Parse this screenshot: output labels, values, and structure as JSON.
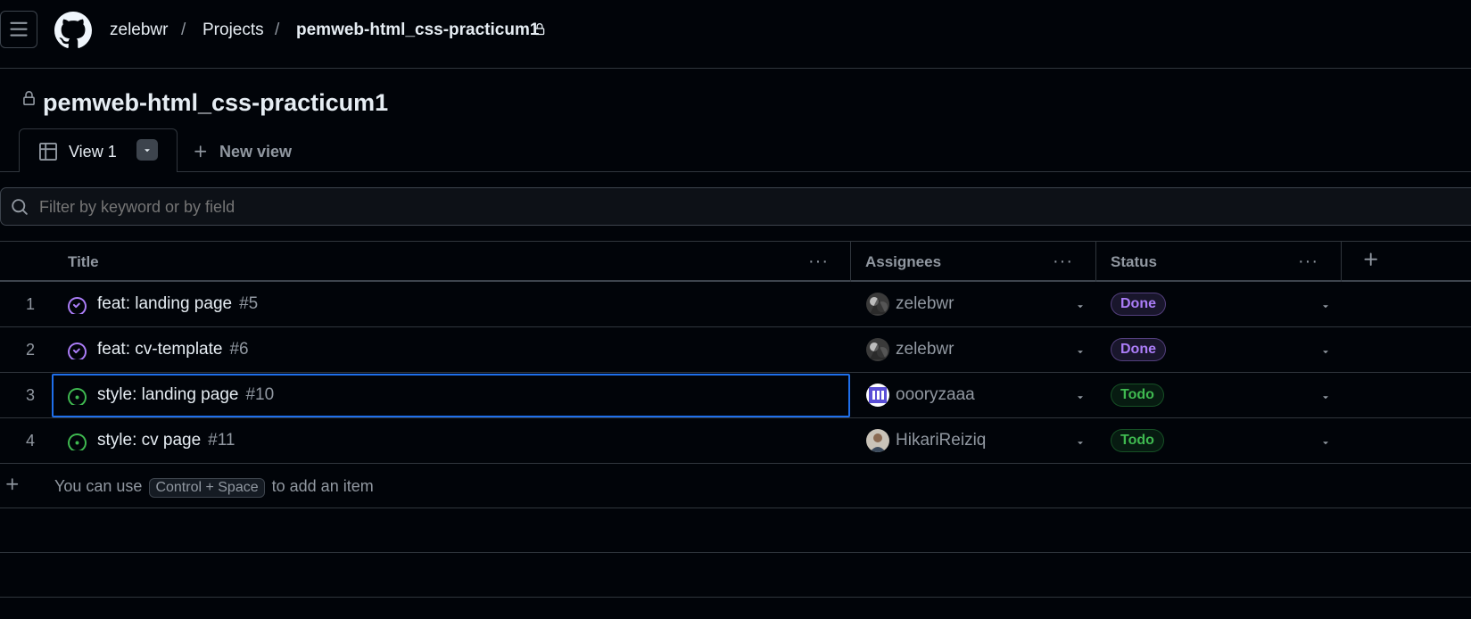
{
  "header": {
    "owner": "zelebwr",
    "section": "Projects",
    "repo": "pemweb-html_css-practicum1",
    "separator": "/"
  },
  "project": {
    "title": "pemweb-html_css-practicum1"
  },
  "views": {
    "active_tab": "View 1",
    "new_view_label": "New view"
  },
  "filter": {
    "placeholder": "Filter by keyword or by field"
  },
  "table": {
    "columns": [
      "Title",
      "Assignees",
      "Status"
    ],
    "menu_glyph": "···",
    "rows": [
      {
        "index": "1",
        "title": "feat: landing page",
        "number": "#5",
        "state": "closed",
        "assignee": "zelebwr",
        "status": "Done"
      },
      {
        "index": "2",
        "title": "feat: cv-template",
        "number": "#6",
        "state": "closed",
        "assignee": "zelebwr",
        "status": "Done"
      },
      {
        "index": "3",
        "title": "style: landing page",
        "number": "#10",
        "state": "open",
        "assignee": "oooryzaaa",
        "status": "Todo"
      },
      {
        "index": "4",
        "title": "style: cv page",
        "number": "#11",
        "state": "open",
        "assignee": "HikariReiziq",
        "status": "Todo"
      }
    ],
    "add_item": {
      "prefix": "You can use",
      "shortcut": "Control + Space",
      "suffix": "to add an item"
    }
  },
  "colors": {
    "background": "#010409",
    "border": "#30363d",
    "text": "#e6edf3",
    "muted": "#9198a1",
    "done": "#ab7df8",
    "todo": "#3fb950",
    "focus": "#1f6feb"
  }
}
